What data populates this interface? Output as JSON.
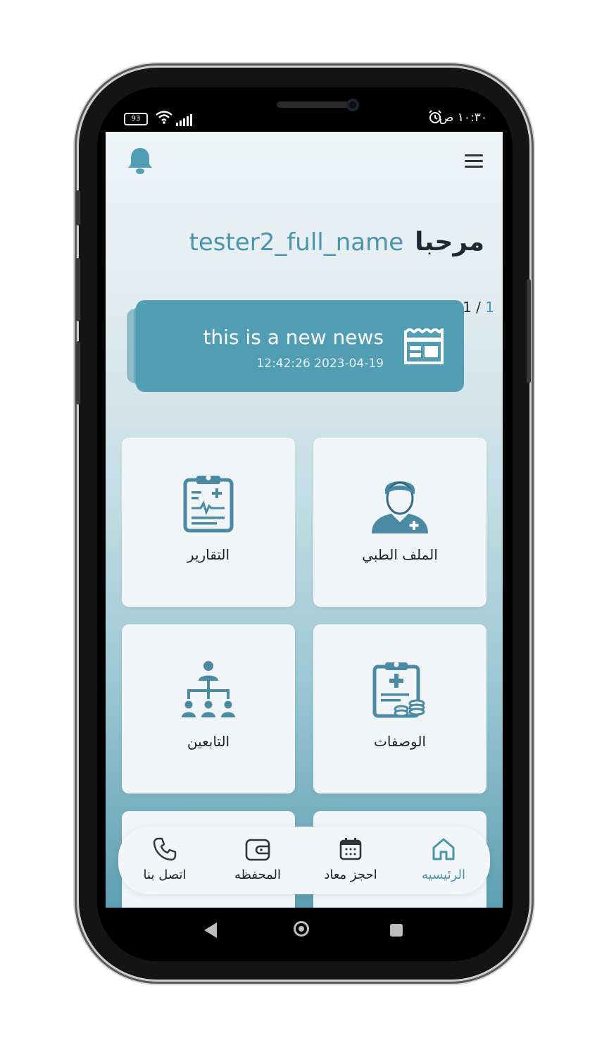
{
  "status_bar": {
    "battery": "93",
    "time": "١٠:٣٠ ص"
  },
  "header": {
    "notifications_icon": "bell-icon",
    "menu_icon": "hamburger-menu-icon"
  },
  "welcome": {
    "greeting": "مرحبا",
    "user_name": "tester2_full_name"
  },
  "news": {
    "pager_current": "1",
    "pager_separator": " / ",
    "pager_total": "1",
    "title": "this is a new news",
    "date": "12:42:26 2023-04-19",
    "icon": "newspaper-icon"
  },
  "cards": [
    {
      "label": "الملف الطبي",
      "icon": "doctor-icon"
    },
    {
      "label": "التقارير",
      "icon": "clipboard-report-icon"
    },
    {
      "label": "الوصفات",
      "icon": "prescription-icon"
    },
    {
      "label": "التابعين",
      "icon": "org-chart-icon"
    }
  ],
  "bottom_nav": [
    {
      "label": "الرئيسيه",
      "icon": "home-icon",
      "active": true
    },
    {
      "label": "احجز معاد",
      "icon": "calendar-icon",
      "active": false
    },
    {
      "label": "المحفظه",
      "icon": "wallet-icon",
      "active": false
    },
    {
      "label": "اتصل بنا",
      "icon": "phone-icon",
      "active": false
    }
  ],
  "colors": {
    "accent": "#4a95ad",
    "news_bg": "#519db4",
    "card_bg": "#f1f5f8"
  }
}
